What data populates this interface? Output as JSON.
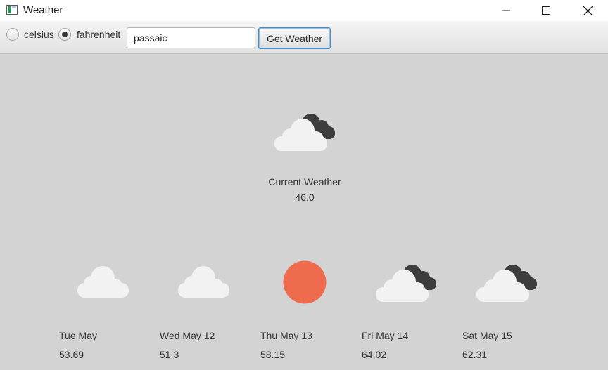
{
  "window": {
    "title": "Weather",
    "icon": "app-window-icon",
    "controls": [
      "minimize-icon",
      "maximize-icon",
      "close-icon"
    ]
  },
  "toolbar": {
    "units": [
      {
        "label": "celsius",
        "selected": false
      },
      {
        "label": "fahrenheit",
        "selected": true
      }
    ],
    "city_value": "passaic",
    "button_label": "Get Weather"
  },
  "current": {
    "icon": "partly-cloudy-icon",
    "label": "Current Weather",
    "value": "46.0"
  },
  "forecast": [
    {
      "day": "Tue May",
      "temp": "53.69",
      "icon": "cloud-icon"
    },
    {
      "day": "Wed May 12",
      "temp": "51.3",
      "icon": "cloud-icon"
    },
    {
      "day": "Thu May 13",
      "temp": "58.15",
      "icon": "sun-icon"
    },
    {
      "day": "Fri May 14",
      "temp": "64.02",
      "icon": "partly-cloudy-icon"
    },
    {
      "day": "Sat May 15",
      "temp": "62.31",
      "icon": "partly-cloudy-icon"
    }
  ],
  "colors": {
    "background": "#d3d3d3",
    "cloud_light": "#f2f2f2",
    "cloud_dark": "#3d3d3d",
    "sun": "#ee6c4d",
    "button_focus": "#3d8fd6"
  }
}
